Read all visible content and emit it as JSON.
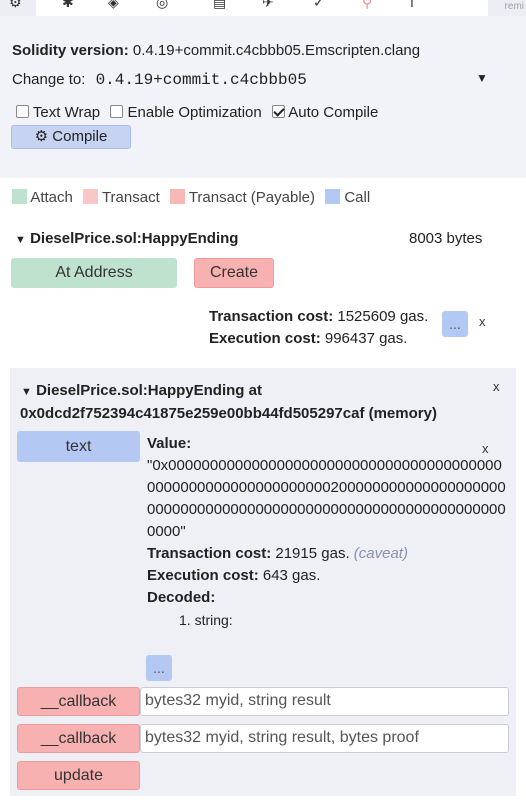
{
  "topbar": {
    "remix_label": "remi"
  },
  "compile": {
    "version_label": "Solidity version:",
    "version_value": "0.4.19+commit.c4cbbb05.Emscripten.clang",
    "change_label": "Change to:",
    "change_value": "0.4.19+commit.c4cbbb05",
    "text_wrap_label": "Text Wrap",
    "enable_opt_label": "Enable Optimization",
    "auto_compile_label": "Auto Compile",
    "compile_button_label": "Compile",
    "checks": {
      "text_wrap": false,
      "enable_optimization": false,
      "auto_compile": true
    }
  },
  "legend": {
    "attach": "Attach",
    "transact": "Transact",
    "transact_payable": "Transact (Payable)",
    "call": "Call"
  },
  "contract": {
    "name": "DieselPrice.sol:HappyEnding",
    "size": "8003 bytes",
    "at_address_label": "At Address",
    "create_label": "Create",
    "tx_cost_label": "Transaction cost:",
    "tx_cost_value": "1525609 gas.",
    "exec_cost_label": "Execution cost:",
    "exec_cost_value": "996437 gas.",
    "more_label": "...",
    "close_label": "x"
  },
  "instance": {
    "title_line1": "DieselPrice.sol:HappyEnding at",
    "title_line2": "0x0dcd2f752394c41875e259e00bb44fd505297caf (memory)",
    "close_label": "x",
    "text_button": "text",
    "result_close": "x",
    "value_label": "Value:",
    "value_lines": [
      "\"0x0000000000000000000000000000000000000000",
      "0000000000000000000000200000000000000000000",
      "0000000000000000000000000000000000000000000",
      "0000\""
    ],
    "tx_cost_label": "Transaction cost:",
    "tx_cost_value": "21915 gas.",
    "caveat": "(caveat)",
    "exec_cost_label": "Execution cost:",
    "exec_cost_value": "643 gas.",
    "decoded_label": "Decoded:",
    "decoded_item": "1. string:",
    "more_label": "...",
    "functions": [
      {
        "label": "__callback",
        "placeholder": "bytes32 myid, string result"
      },
      {
        "label": "__callback",
        "placeholder": "bytes32 myid, string result, bytes proof"
      }
    ],
    "update_label": "update"
  }
}
